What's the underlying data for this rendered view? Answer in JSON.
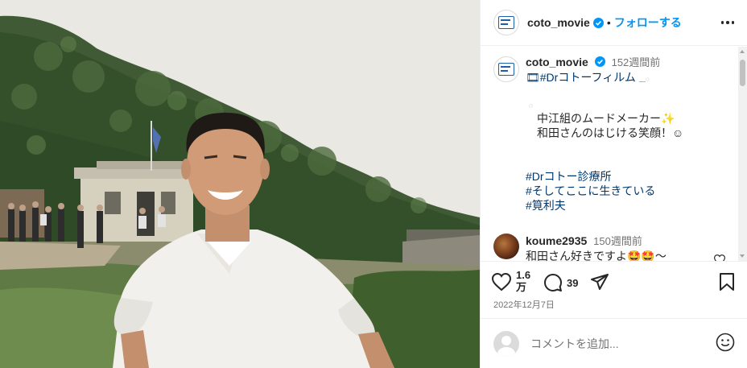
{
  "post": {
    "username": "coto_movie",
    "separator": "•",
    "follow_label": "フォローする"
  },
  "caption": {
    "username": "coto_movie",
    "time": "152週間前",
    "line1": "🎞#Drコトーフィルム",
    "line1_tail": "﹏◌",
    "small_mark": "◌",
    "text1": "中江組のムードメーカー✨",
    "text2": "和田さんのはじける笑顔！☺",
    "tags": [
      "#Drコトー診療所",
      "#そしてここに生きている",
      "#筧利夫"
    ]
  },
  "comment": {
    "username": "koume2935",
    "time": "150週間前",
    "text": "和田さん好きですよ🤩🤩〜"
  },
  "actions": {
    "likes": "1.6",
    "likes_unit": "万",
    "comments": "39",
    "date": "2022年12月7日"
  },
  "add_comment": {
    "placeholder": "コメントを追加..."
  },
  "colors": {
    "accent": "#0095f6",
    "hashtag": "#00376b",
    "verified": "#0095f6"
  },
  "icons": {
    "more": "more-horizontal-icon",
    "like": "heart-icon",
    "comment": "comment-bubble-icon",
    "share": "paper-plane-icon",
    "save": "bookmark-icon",
    "emoji": "smiley-icon"
  }
}
